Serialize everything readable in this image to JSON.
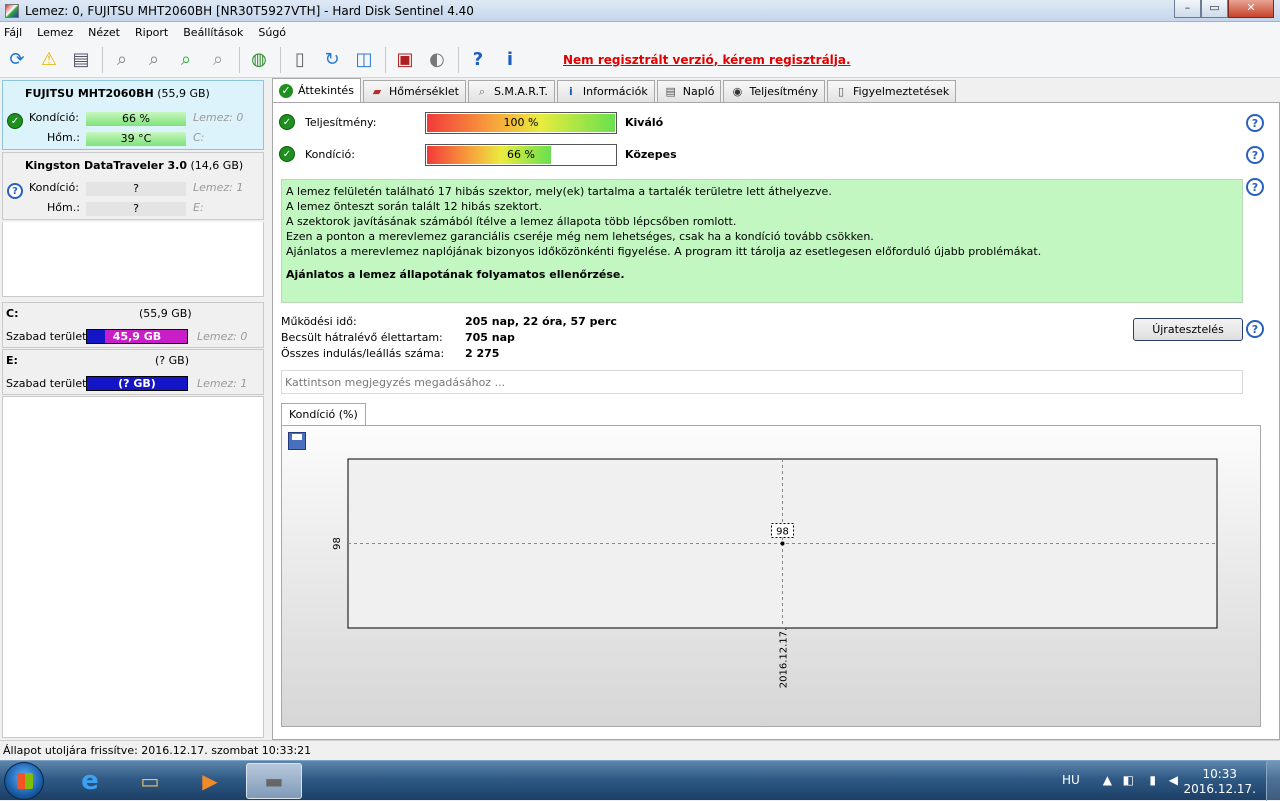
{
  "window": {
    "title": "Lemez: 0, FUJITSU MHT2060BH [NR30T5927VTH]  -  Hard Disk Sentinel 4.40",
    "min": "–",
    "max": "▭",
    "close": "✕"
  },
  "menu": [
    "Fájl",
    "Lemez",
    "Nézet",
    "Riport",
    "Beállítások",
    "Súgó"
  ],
  "toolbar": {
    "register_text": "Nem regisztrált verzió, kérem regisztrálja."
  },
  "disks": [
    {
      "name": "FUJITSU MHT2060BH",
      "size": "(55,9 GB)",
      "condition_label": "Kondíció:",
      "condition_value": "66 %",
      "disk_ref": "Lemez: 0",
      "temp_label": "Hőm.:",
      "temp_value": "39 °C",
      "drive": "C:"
    },
    {
      "name": "Kingston DataTraveler 3.0",
      "size": "(14,6 GB)",
      "condition_label": "Kondíció:",
      "condition_value": "?",
      "disk_ref": "Lemez: 1",
      "temp_label": "Hőm.:",
      "temp_value": "?",
      "drive": "E:"
    }
  ],
  "volumes": [
    {
      "letter": "C:",
      "size": "(55,9 GB)",
      "free_label": "Szabad terület",
      "free_value": "45,9 GB",
      "disk_ref": "Lemez: 0",
      "used_fraction": 0.18
    },
    {
      "letter": "E:",
      "size": "(? GB)",
      "free_label": "Szabad terület",
      "free_value": "(? GB)",
      "disk_ref": "Lemez: 1",
      "used_fraction": 0
    }
  ],
  "tabs": [
    "Áttekintés",
    "Hőmérséklet",
    "S.M.A.R.T.",
    "Információk",
    "Napló",
    "Teljesítmény",
    "Figyelmeztetések"
  ],
  "overview": {
    "performance_label": "Teljesítmény:",
    "performance_value": "100 %",
    "performance_fraction": 1.0,
    "performance_word": "Kiváló",
    "condition_label": "Kondíció:",
    "condition_value": "66 %",
    "condition_fraction": 0.66,
    "condition_word": "Közepes",
    "messages": [
      "A lemez felületén található 17 hibás szektor, mely(ek) tartalma a tartalék területre lett áthelyezve.",
      "A lemez önteszt során talált 12 hibás szektort.",
      "A szektorok javításának számából ítélve a lemez állapota több lépcsőben romlott.",
      "Ezen a ponton a merevlemez garanciális cseréje még nem lehetséges, csak ha a kondíció tovább csökken.",
      "Ajánlatos a merevlemez naplójának bizonyos időközönkénti figyelése. A program itt tárolja az esetlegesen előforduló újabb problémákat."
    ],
    "recommendation": "Ajánlatos a lemez állapotának folyamatos ellenőrzése.",
    "stats": [
      {
        "label": "Működési idő:",
        "value": "205 nap, 22 óra, 57 perc"
      },
      {
        "label": "Becsült hátralévő élettartam:",
        "value": "705 nap"
      },
      {
        "label": "Összes indulás/leállás száma:",
        "value": "2 275"
      }
    ],
    "retest_button": "Újratesztelés",
    "note_placeholder": "Kattintson megjegyzés megadásához ...",
    "graph_tab": "Kondíció  (%)"
  },
  "chart_data": {
    "type": "line",
    "x": [
      "2016.12.17."
    ],
    "series": [
      {
        "values": [
          98
        ]
      }
    ],
    "ylabel_tick": "98",
    "data_label": "98",
    "grid": true
  },
  "statusbar": "Állapot utoljára frissítve: 2016.12.17. szombat 10:33:21",
  "taskbar": {
    "lang": "HU",
    "time": "10:33",
    "date": "2016.12.17."
  }
}
